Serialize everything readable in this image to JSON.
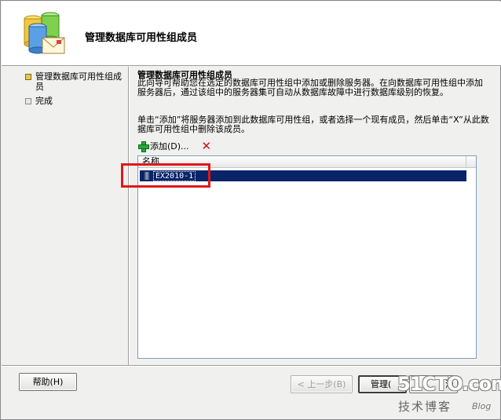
{
  "header": {
    "title": "管理数据库可用性组成员"
  },
  "nav": {
    "items": [
      {
        "label": "管理数据库可用性组成员",
        "active": true
      },
      {
        "label": "完成",
        "active": false
      }
    ]
  },
  "content": {
    "section_title": "管理数据库可用性组成员",
    "description": "此向导可帮助您在选定的数据库可用性组中添加或删除服务器。在向数据库可用性组中添加服务器后，通过该组中的服务器集可自动从数据库故障中进行数据库级别的恢复。",
    "instruction": "单击“添加”将服务器添加到此数据库可用性组，或者选择一个现有成员，然后单击“X”从此数据库可用性组中删除该成员。",
    "toolbar": {
      "add_label": "添加(D)...",
      "delete_glyph": "✕"
    },
    "list": {
      "column_header": "名称",
      "rows": [
        {
          "name": "EX2010-1",
          "selected": true
        }
      ]
    }
  },
  "buttons": {
    "help": "帮助(H)",
    "back": "< 上一步(B)",
    "manage": "管理(",
    "cancel_partial": "消"
  },
  "watermark": {
    "logo": "51CTO.com",
    "sub": "技术博客",
    "blog": "Blog"
  },
  "colors": {
    "selection": "#0a246a",
    "highlight_box": "#e01818",
    "active_bullet": "#e8c64a"
  }
}
